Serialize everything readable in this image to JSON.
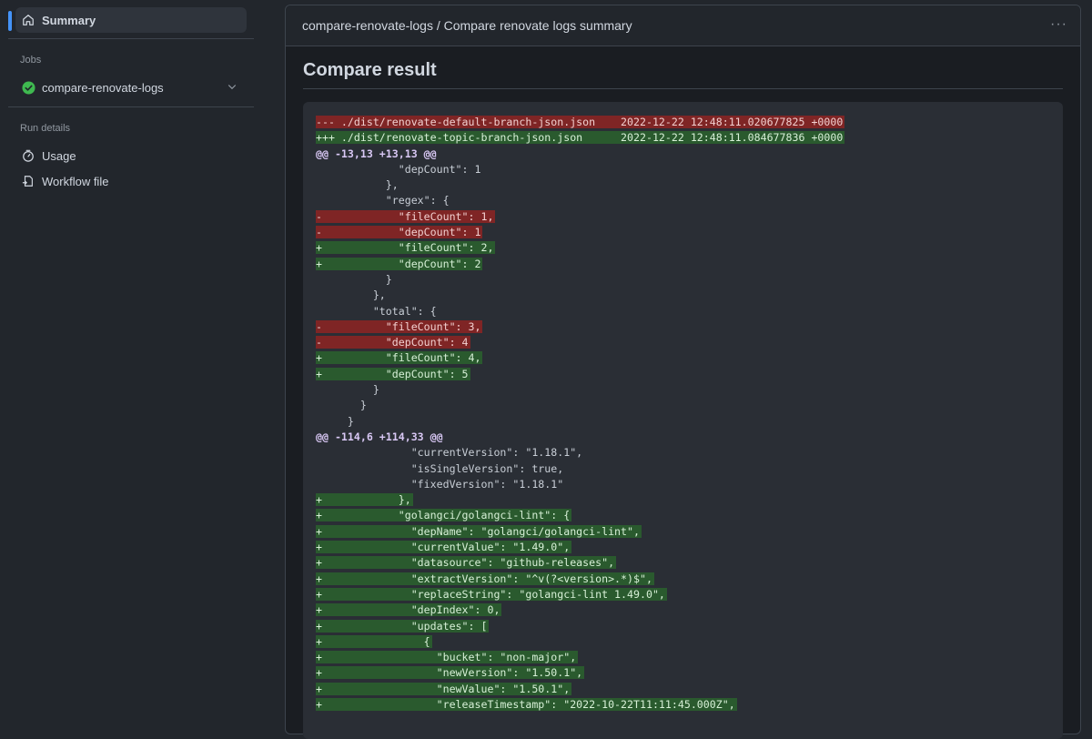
{
  "sidebar": {
    "summary_label": "Summary",
    "jobs_title": "Jobs",
    "job_label": "compare-renovate-logs",
    "run_details_title": "Run details",
    "usage_label": "Usage",
    "workflow_file_label": "Workflow file"
  },
  "main": {
    "header_title": "compare-renovate-logs / Compare renovate logs summary",
    "more_label": "···",
    "result_title": "Compare result"
  },
  "diff_lines": [
    {
      "type": "del",
      "text": "--- ./dist/renovate-default-branch-json.json    2022-12-22 12:48:11.020677825 +0000"
    },
    {
      "type": "add",
      "text": "+++ ./dist/renovate-topic-branch-json.json      2022-12-22 12:48:11.084677836 +0000"
    },
    {
      "type": "hunk",
      "text": "@@ -13,13 +13,13 @@"
    },
    {
      "type": "ctx",
      "text": "             \"depCount\": 1"
    },
    {
      "type": "ctx",
      "text": "           },"
    },
    {
      "type": "ctx",
      "text": "           \"regex\": {"
    },
    {
      "type": "del",
      "text": "-            \"fileCount\": 1,"
    },
    {
      "type": "del",
      "text": "-            \"depCount\": 1"
    },
    {
      "type": "add",
      "text": "+            \"fileCount\": 2,"
    },
    {
      "type": "add",
      "text": "+            \"depCount\": 2"
    },
    {
      "type": "ctx",
      "text": "           }"
    },
    {
      "type": "ctx",
      "text": "         },"
    },
    {
      "type": "ctx",
      "text": "         \"total\": {"
    },
    {
      "type": "del",
      "text": "-          \"fileCount\": 3,"
    },
    {
      "type": "del",
      "text": "-          \"depCount\": 4"
    },
    {
      "type": "add",
      "text": "+          \"fileCount\": 4,"
    },
    {
      "type": "add",
      "text": "+          \"depCount\": 5"
    },
    {
      "type": "ctx",
      "text": "         }"
    },
    {
      "type": "ctx",
      "text": "       }"
    },
    {
      "type": "ctx",
      "text": "     }"
    },
    {
      "type": "hunk",
      "text": "@@ -114,6 +114,33 @@"
    },
    {
      "type": "ctx",
      "text": "               \"currentVersion\": \"1.18.1\","
    },
    {
      "type": "ctx",
      "text": "               \"isSingleVersion\": true,"
    },
    {
      "type": "ctx",
      "text": "               \"fixedVersion\": \"1.18.1\""
    },
    {
      "type": "add",
      "text": "+            },"
    },
    {
      "type": "add",
      "text": "+            \"golangci/golangci-lint\": {"
    },
    {
      "type": "add",
      "text": "+              \"depName\": \"golangci/golangci-lint\","
    },
    {
      "type": "add",
      "text": "+              \"currentValue\": \"1.49.0\","
    },
    {
      "type": "add",
      "text": "+              \"datasource\": \"github-releases\","
    },
    {
      "type": "add",
      "text": "+              \"extractVersion\": \"^v(?<version>.*)$\","
    },
    {
      "type": "add",
      "text": "+              \"replaceString\": \"golangci-lint 1.49.0\","
    },
    {
      "type": "add",
      "text": "+              \"depIndex\": 0,"
    },
    {
      "type": "add",
      "text": "+              \"updates\": ["
    },
    {
      "type": "add",
      "text": "+                {"
    },
    {
      "type": "add",
      "text": "+                  \"bucket\": \"non-major\","
    },
    {
      "type": "add",
      "text": "+                  \"newVersion\": \"1.50.1\","
    },
    {
      "type": "add",
      "text": "+                  \"newValue\": \"1.50.1\","
    },
    {
      "type": "add",
      "text": "+                  \"releaseTimestamp\": \"2022-10-22T11:11:45.000Z\","
    }
  ]
}
